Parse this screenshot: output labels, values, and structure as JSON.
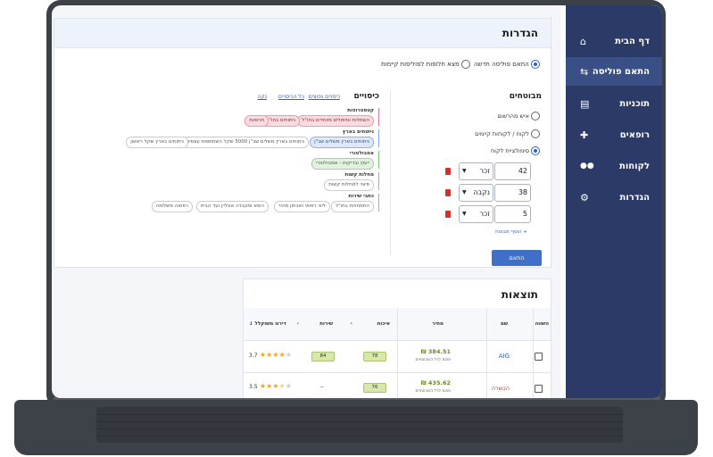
{
  "sidebar": {
    "items": [
      {
        "label": "דף הבית",
        "icon": "home-icon",
        "glyph": "⌂"
      },
      {
        "label": "התאם פוליסה",
        "icon": "compare-arrows-icon",
        "glyph": "⇆"
      },
      {
        "label": "תוכניות",
        "icon": "document-icon",
        "glyph": "▤"
      },
      {
        "label": "רופאים",
        "icon": "medical-plus-icon",
        "glyph": "✚"
      },
      {
        "label": "לקוחות",
        "icon": "people-icon",
        "glyph": "👥"
      },
      {
        "label": "הגדרות",
        "icon": "gear-icon",
        "glyph": "⚙"
      }
    ],
    "active_index": 1
  },
  "settings": {
    "title": "הגדרות",
    "mode_new": "התאם פוליסה חדשה",
    "mode_existing": "מצא חלופות לפוליסות קיימות",
    "insured": {
      "title": "מבוטחים",
      "opt1": "איש מהרשום",
      "opt2": "לקוח / לקוחות קיימים",
      "opt3": "סימולציית לקוח",
      "rows": [
        {
          "age": "42",
          "gender": "זכר"
        },
        {
          "age": "38",
          "gender": "נקבה"
        },
        {
          "age": "5",
          "gender": "זכר"
        }
      ],
      "add_label": "+ הוסף מבוטח"
    },
    "coverage": {
      "title": "כיסויים",
      "link_all": "כל הכיסויים",
      "link_special": "כיסויים נפוצים",
      "link_clear": "נקה",
      "groups": [
        {
          "name": "קטסטרופות",
          "chips": [
            "השתלות וטיפולים מיוחדים בחו\"ל",
            "ניתוחים בחו\"ל",
            "תרופות"
          ]
        },
        {
          "name": "ניתוחים בארץ",
          "chips": [
            "ניתוחים בארץ משלים שב\"ן",
            "ניתוחים בארץ משלים שב\"ן 5000 שקל השתתפות עצמית",
            "ניתוחים בארץ שקל ראשון"
          ]
        },
        {
          "name": "אמבולטורי",
          "chips": [
            "ייעוץ ובדיקות - אמבולטורי"
          ]
        },
        {
          "name": "מחלות קשות",
          "chips": [
            "פיצוי למחלות קשות"
          ]
        },
        {
          "name": "כתבי שירות",
          "chips": [
            "התמחויות בחו\"ל",
            "ליווי רפואי ואבחון מהיר",
            "רופא ומעבדה אונליין ועד הבית",
            "רפואה משלימה"
          ]
        }
      ]
    },
    "submit_label": "התאם"
  },
  "results": {
    "title": "תוצאות",
    "columns": {
      "compare": "השווה",
      "name": "שם",
      "price": "מחיר",
      "quality": "איכות",
      "service": "שירות",
      "rating": "דירוג משוקלל"
    },
    "rows": [
      {
        "name": "AIG",
        "name_color": "#2f5fcc",
        "price": "384.51 ₪",
        "price_note": "סכום לכל המבוטחים",
        "quality": "78",
        "service": "84",
        "rating": "3.7",
        "stars": 3.7
      },
      {
        "name": "הכשרה",
        "name_color": "#c0392b",
        "price": "435.62 ₪",
        "price_note": "סכום לכל המבוטחים",
        "quality": "76",
        "service": "–",
        "rating": "3.5",
        "stars": 3.5
      }
    ]
  },
  "colors": {
    "sidebar": "#2b3a67",
    "accent": "#3f6fc6",
    "danger": "#d22f2f"
  }
}
